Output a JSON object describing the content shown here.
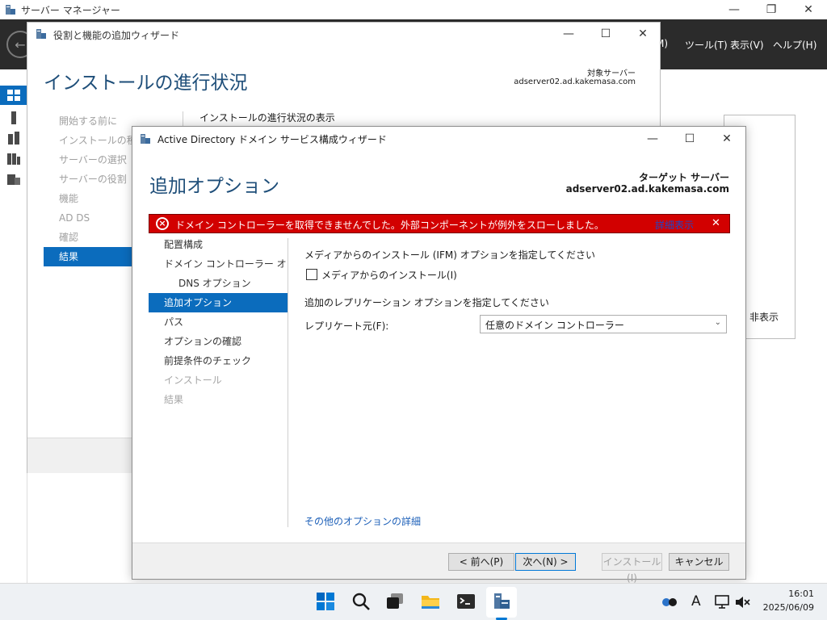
{
  "server_manager": {
    "title": "サーバー マネージャー",
    "menu": {
      "manage": "M)",
      "tools": "ツール(T)",
      "view": "表示(V)",
      "help": "ヘルプ(H)"
    },
    "hide_label": "非表示"
  },
  "roles_wizard": {
    "title": "役割と機能の追加ウィザード",
    "heading": "インストールの進行状況",
    "target_label": "対象サーバー",
    "target_value": "adserver02.ad.kakemasa.com",
    "steps": [
      "開始する前に",
      "インストールの種類",
      "サーバーの選択",
      "サーバーの役割",
      "機能",
      "AD DS",
      "確認",
      "結果"
    ],
    "active_step": "結果",
    "progress_title": "インストールの進行状況の表示"
  },
  "adds_wizard": {
    "title": "Active Directory ドメイン サービス構成ウィザード",
    "heading": "追加オプション",
    "target_label": "ターゲット サーバー",
    "target_value": "adserver02.ad.kakemasa.com",
    "error": {
      "message": "ドメイン コントローラーを取得できませんでした。外部コンポーネントが例外をスローしました。",
      "details_link": "詳細表示",
      "close": "✕"
    },
    "steps": [
      {
        "label": "配置構成",
        "state": "normal"
      },
      {
        "label": "ドメイン コントローラー オプション",
        "state": "normal"
      },
      {
        "label": "DNS オプション",
        "state": "sub"
      },
      {
        "label": "追加オプション",
        "state": "active"
      },
      {
        "label": "パス",
        "state": "normal"
      },
      {
        "label": "オプションの確認",
        "state": "normal"
      },
      {
        "label": "前提条件のチェック",
        "state": "normal"
      },
      {
        "label": "インストール",
        "state": "disabled"
      },
      {
        "label": "結果",
        "state": "disabled"
      }
    ],
    "ifm_title": "メディアからのインストール (IFM) オプションを指定してください",
    "ifm_checkbox_label": "メディアからのインストール(I)",
    "ifm_checked": false,
    "replication_title": "追加のレプリケーション オプションを指定してください",
    "replicate_from_label": "レプリケート元(F):",
    "replicate_from_value": "任意のドメイン コントローラー",
    "more_options_link": "その他のオプションの詳細",
    "buttons": {
      "previous": "< 前へ(P)",
      "next": "次へ(N) >",
      "install": "インストール(I)",
      "cancel": "キャンセル"
    }
  },
  "taskbar": {
    "icons": [
      "start-icon",
      "search-icon",
      "task-view-icon",
      "file-explorer-icon",
      "terminal-icon",
      "server-manager-icon"
    ],
    "ime": "A",
    "time": "16:01",
    "date": "2025/06/09"
  },
  "colors": {
    "accent": "#0b6cbd",
    "heading": "#1e4e79",
    "error_bg": "#d20000",
    "link": "#1c5fb8"
  }
}
